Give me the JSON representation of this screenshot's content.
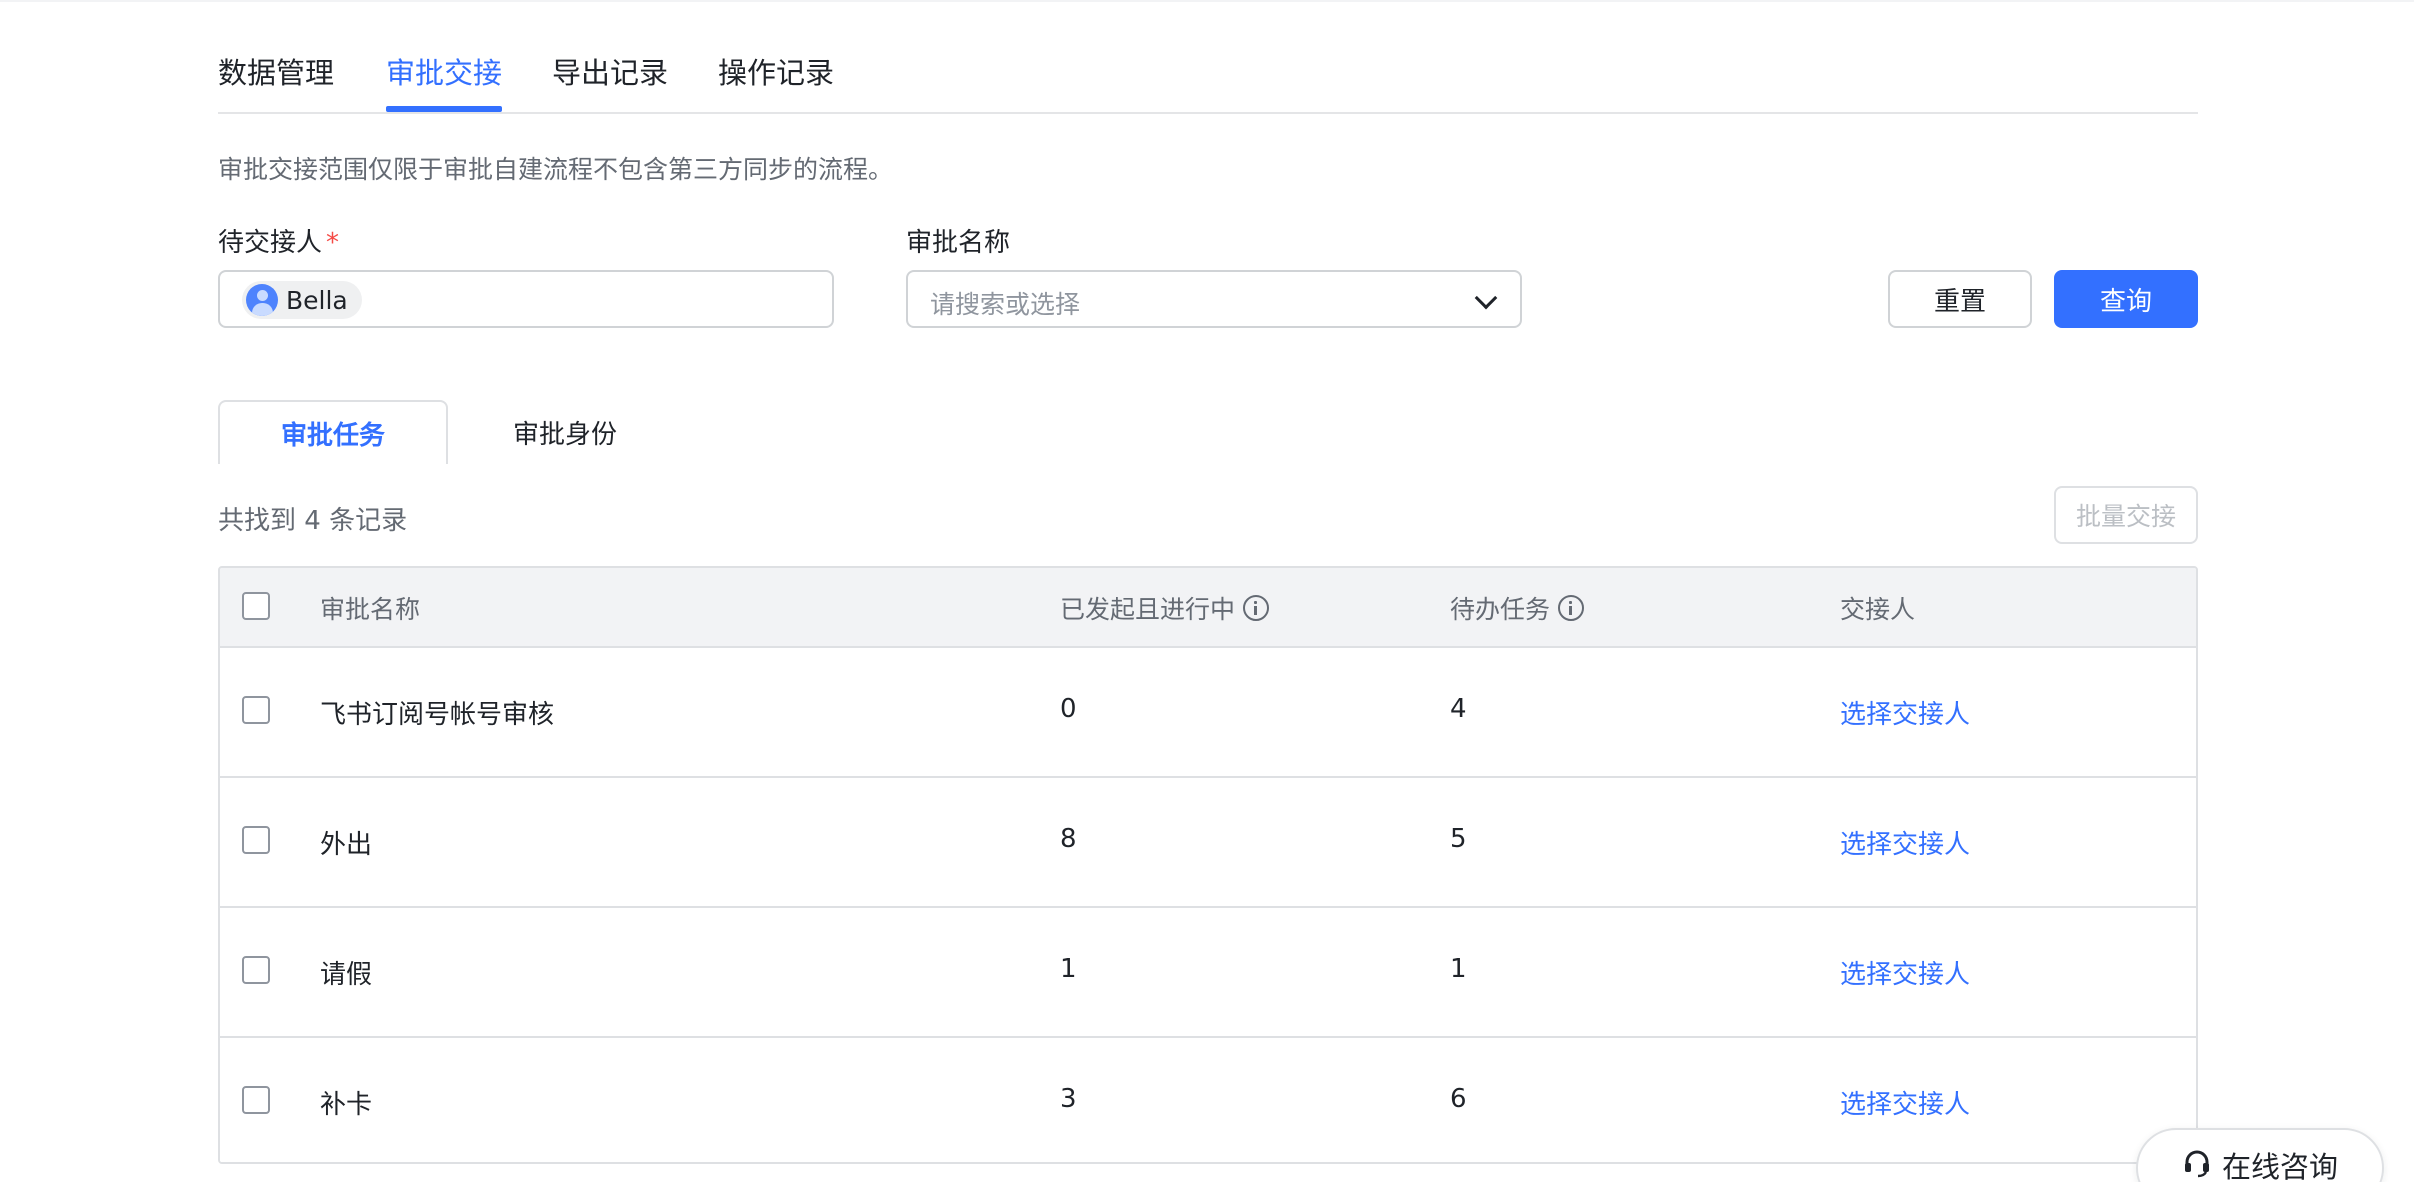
{
  "top_tabs": [
    {
      "label": "数据管理",
      "active": false
    },
    {
      "label": "审批交接",
      "active": true
    },
    {
      "label": "导出记录",
      "active": false
    },
    {
      "label": "操作记录",
      "active": false
    }
  ],
  "notice": "审批交接范围仅限于审批自建流程不包含第三方同步的流程。",
  "form": {
    "handover_from_label": "待交接人",
    "required_mark": "*",
    "handover_from_value": "Bella",
    "approval_name_label": "审批名称",
    "approval_name_placeholder": "请搜索或选择",
    "reset_label": "重置",
    "query_label": "查询"
  },
  "sub_tabs": [
    {
      "label": "审批任务",
      "active": true
    },
    {
      "label": "审批身份",
      "active": false
    }
  ],
  "record_count_text": "共找到 4 条记录",
  "batch_label": "批量交接",
  "table": {
    "columns": [
      "审批名称",
      "已发起且进行中",
      "待办任务",
      "交接人"
    ],
    "rows": [
      {
        "name": "飞书订阅号帐号审核",
        "in_progress": "0",
        "todo": "4",
        "action": "选择交接人"
      },
      {
        "name": "外出",
        "in_progress": "8",
        "todo": "5",
        "action": "选择交接人"
      },
      {
        "name": "请假",
        "in_progress": "1",
        "todo": "1",
        "action": "选择交接人"
      },
      {
        "name": "补卡",
        "in_progress": "3",
        "todo": "6",
        "action": "选择交接人"
      }
    ]
  },
  "consult_label": "在线咨询",
  "colors": {
    "accent": "#3370ff",
    "required": "#f54a45",
    "header_bg": "#f2f3f5"
  }
}
